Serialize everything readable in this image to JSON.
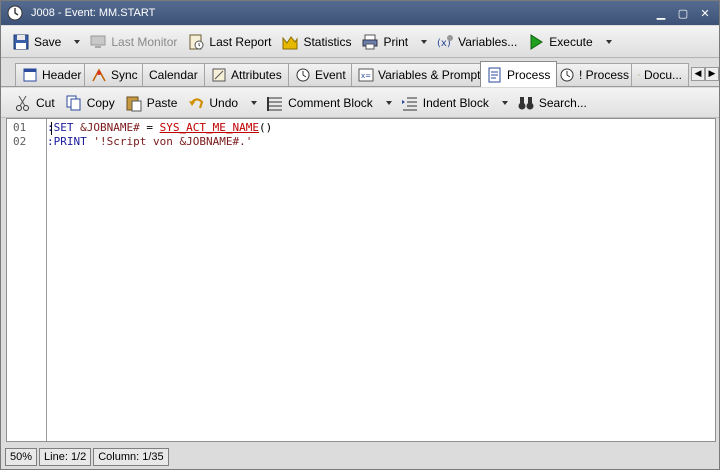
{
  "window": {
    "title": "J008 - Event: MM.START"
  },
  "toolbar": {
    "save": "Save",
    "last_monitor": "Last Monitor",
    "last_report": "Last Report",
    "statistics": "Statistics",
    "print": "Print",
    "variables": "Variables...",
    "execute": "Execute"
  },
  "tabs": [
    {
      "label": "Header"
    },
    {
      "label": "Sync"
    },
    {
      "label": "Calendar"
    },
    {
      "label": "Attributes"
    },
    {
      "label": "Event"
    },
    {
      "label": "Variables & Prompts"
    },
    {
      "label": "Process"
    },
    {
      "label": "! Process"
    },
    {
      "label": "Docu..."
    }
  ],
  "active_tab": "Process",
  "edit_toolbar": {
    "cut": "Cut",
    "copy": "Copy",
    "paste": "Paste",
    "undo": "Undo",
    "comment_block": "Comment Block",
    "indent_block": "Indent Block",
    "search": "Search..."
  },
  "editor": {
    "line_numbers": [
      "01",
      "02"
    ],
    "line1": {
      "kw": ":SET",
      "var": "&JOBNAME#",
      "op": " = ",
      "fn": "SYS_ACT_ME_NAME",
      "paren": "()"
    },
    "line2": {
      "kw": ":PRINT",
      "str": "'!Script von &JOBNAME#.'"
    }
  },
  "status": {
    "zoom": "50%",
    "line": "Line: 1/2",
    "column": "Column: 1/35"
  },
  "colors": {
    "titlebar": "#3d5278",
    "keyword": "#1a1a9c",
    "function": "#c00000"
  }
}
